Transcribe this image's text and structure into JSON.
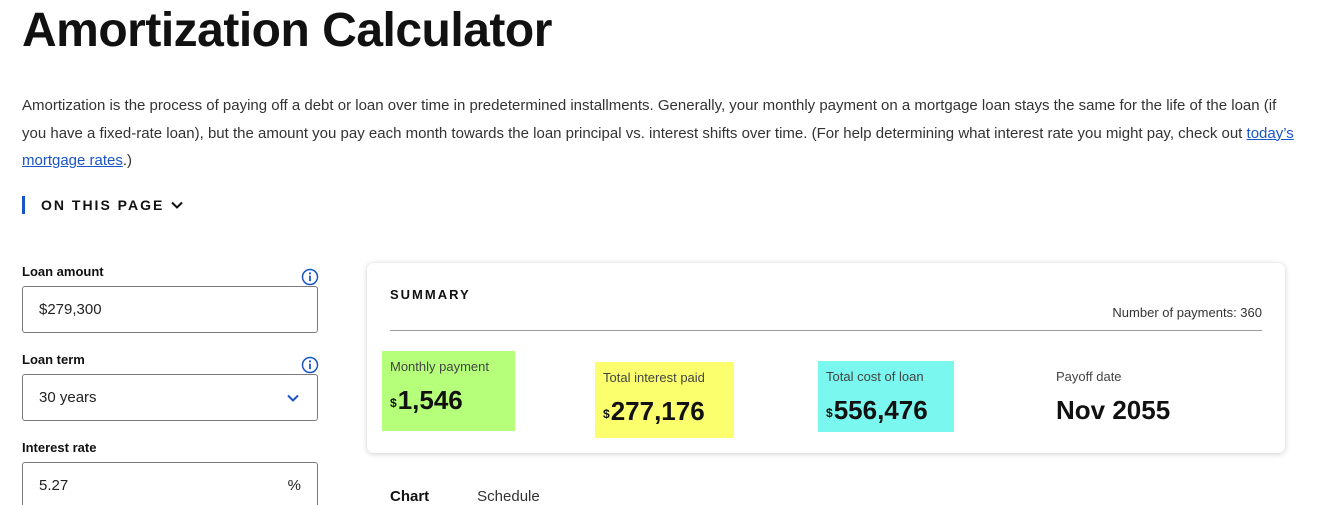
{
  "header": {
    "title": "Amortization Calculator",
    "intro_before_link": "Amortization is the process of paying off a debt or loan over time in predetermined installments. Generally, your monthly payment on a mortgage loan stays the same for the life of the loan (if you have a fixed-rate loan), but the amount you pay each month towards the loan principal vs. interest shifts over time. (For help determining what interest rate you might pay, check out ",
    "intro_link": "today’s mortgage rates",
    "intro_after_link": ".)"
  },
  "on_this_page": {
    "label": "ON THIS PAGE",
    "icon": "chevron-down-icon"
  },
  "form": {
    "loan_amount": {
      "label": "Loan amount",
      "value": "$279,300",
      "info_icon": "info-icon"
    },
    "loan_term": {
      "label": "Loan term",
      "value": "30 years",
      "info_icon": "info-icon"
    },
    "interest_rate": {
      "label": "Interest rate",
      "value": "5.27",
      "suffix": "%"
    }
  },
  "summary": {
    "title": "SUMMARY",
    "number_of_payments": "Number of payments: 360",
    "monthly_payment": {
      "label": "Monthly payment",
      "currency": "$",
      "value": "1,546",
      "highlight": "#b5ff7a"
    },
    "total_interest": {
      "label": "Total interest paid",
      "currency": "$",
      "value": "277,176",
      "highlight": "#fbff6e"
    },
    "total_cost": {
      "label": "Total cost of loan",
      "currency": "$",
      "value": "556,476",
      "highlight": "#7af7ee"
    },
    "payoff_date": {
      "label": "Payoff date",
      "value": "Nov 2055"
    }
  },
  "tabs": [
    {
      "label": "Chart",
      "active": true
    },
    {
      "label": "Schedule",
      "active": false
    }
  ],
  "colors": {
    "accent": "#1a55c8",
    "text": "#111111"
  }
}
